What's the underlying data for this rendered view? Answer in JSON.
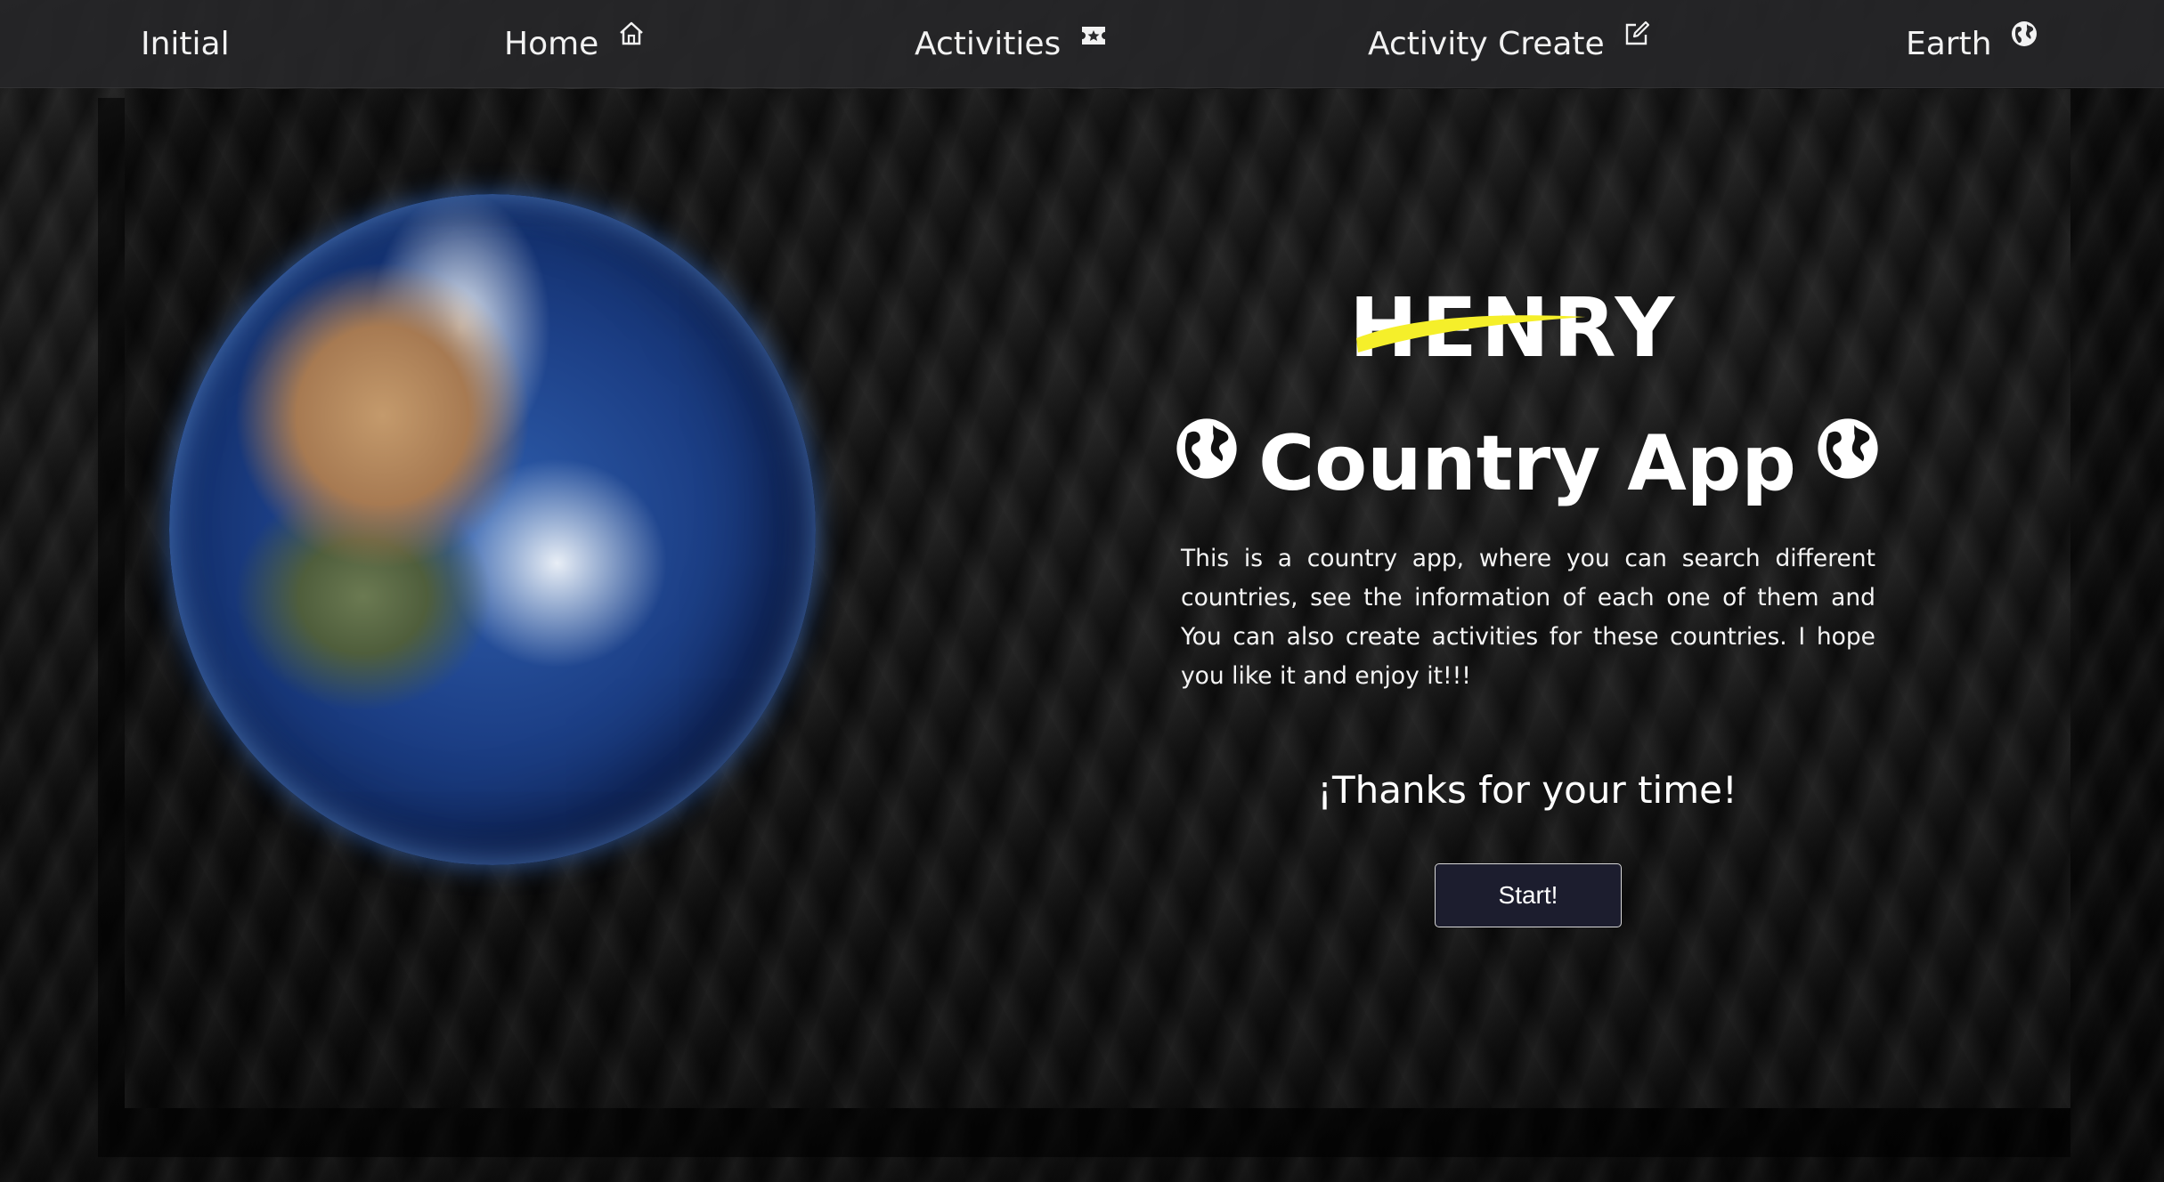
{
  "navbar": {
    "items": [
      {
        "label": "Initial",
        "icon": ""
      },
      {
        "label": "Home",
        "icon": "house-icon"
      },
      {
        "label": "Activities",
        "icon": "ticket-star-icon"
      },
      {
        "label": "Activity Create",
        "icon": "edit-square-icon"
      },
      {
        "label": "Earth",
        "icon": "globe-icon"
      }
    ]
  },
  "hero": {
    "image": "earth-globe",
    "logo_text": "HENRY",
    "logo_accent_color": "#f5ef2a",
    "title": "Country App",
    "title_icon": "globe-icon",
    "description": "This is a country app, where you can search different countries, see the information of each one of them and You can also create activities for these countries. I hope you like it and enjoy it!!!",
    "thanks": "¡Thanks for your time!",
    "start_button": "Start!"
  },
  "colors": {
    "background": "#0d0d0d",
    "navbar": "#262628",
    "button_bg": "#1c1d2e",
    "text": "#ffffff"
  }
}
